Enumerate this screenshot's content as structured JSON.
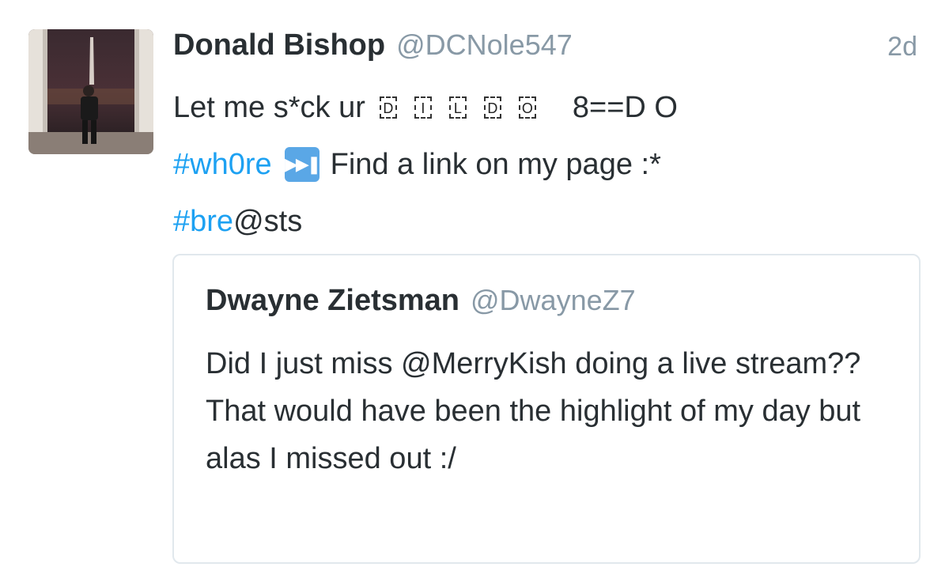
{
  "tweet": {
    "display_name": "Donald Bishop",
    "handle": "@DCNole547",
    "timestamp": "2d",
    "line1_text": "Let me s*ck ur",
    "glyph_boxes": [
      "D",
      "I",
      "L",
      "D",
      "O"
    ],
    "line1_tail": "8==D O",
    "hashtag1": "#wh0re",
    "emoji_name": "fast-forward-emoji",
    "line2_text": "Find a link on my page :*",
    "hashtag2": "#bre",
    "line3_text": "@sts"
  },
  "quoted_tweet": {
    "display_name": "Dwayne Zietsman",
    "handle": "@DwayneZ7",
    "text": "Did I just miss @MerryKish doing a live stream?? That would have been the highlight of my day but alas I missed out :/"
  },
  "colors": {
    "link": "#1da1f2",
    "secondary_text": "#8899a6",
    "primary_text": "#292f33",
    "card_border": "#e1e8ed"
  }
}
